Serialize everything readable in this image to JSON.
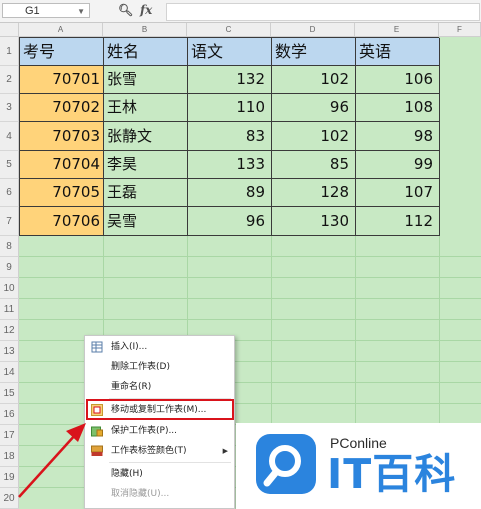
{
  "formula_bar": {
    "cell_ref": "G1",
    "fx_label": "fx",
    "formula_value": ""
  },
  "columns": [
    "A",
    "B",
    "C",
    "D",
    "E",
    "F"
  ],
  "rows": [
    "1",
    "2",
    "3",
    "4",
    "5",
    "6",
    "7",
    "8",
    "9",
    "10",
    "11",
    "12",
    "13",
    "14",
    "15",
    "16",
    "17",
    "18",
    "19",
    "20"
  ],
  "table": {
    "headers": [
      "考号",
      "姓名",
      "语文",
      "数学",
      "英语"
    ],
    "records": [
      [
        "70701",
        "张雪",
        "132",
        "102",
        "106"
      ],
      [
        "70702",
        "王林",
        "110",
        "96",
        "108"
      ],
      [
        "70703",
        "张静文",
        "83",
        "102",
        "98"
      ],
      [
        "70704",
        "李昊",
        "133",
        "85",
        "99"
      ],
      [
        "70705",
        "王磊",
        "89",
        "128",
        "107"
      ],
      [
        "70706",
        "吴雪",
        "96",
        "130",
        "112"
      ]
    ]
  },
  "context_menu": {
    "items": [
      {
        "label": "插入(I)...",
        "icon": "insert-sheet-icon",
        "enabled": true,
        "submenu": false
      },
      {
        "label": "删除工作表(D)",
        "icon": "",
        "enabled": true,
        "submenu": false
      },
      {
        "label": "重命名(R)",
        "icon": "",
        "enabled": true,
        "submenu": false
      },
      {
        "label": "移动或复制工作表(M)...",
        "icon": "move-copy-sheet-icon",
        "enabled": true,
        "submenu": false,
        "highlighted": true
      },
      {
        "label": "保护工作表(P)...",
        "icon": "protect-sheet-icon",
        "enabled": true,
        "submenu": false
      },
      {
        "label": "工作表标签颜色(T)",
        "icon": "tab-color-icon",
        "enabled": true,
        "submenu": true
      },
      {
        "label": "隐藏(H)",
        "icon": "",
        "enabled": true,
        "submenu": false
      },
      {
        "label": "取消隐藏(U)...",
        "icon": "",
        "enabled": false,
        "submenu": false
      }
    ]
  },
  "watermark": {
    "line1": "PConline",
    "line2": "IT百科"
  },
  "colors": {
    "sheet_bg": "#c8e9c4",
    "header_fill": "#bcd7ef",
    "id_fill": "#ffd37a",
    "highlight_box": "#d9131b",
    "annotation_arrow": "#d9131b",
    "brand_blue": "#2b84de"
  }
}
